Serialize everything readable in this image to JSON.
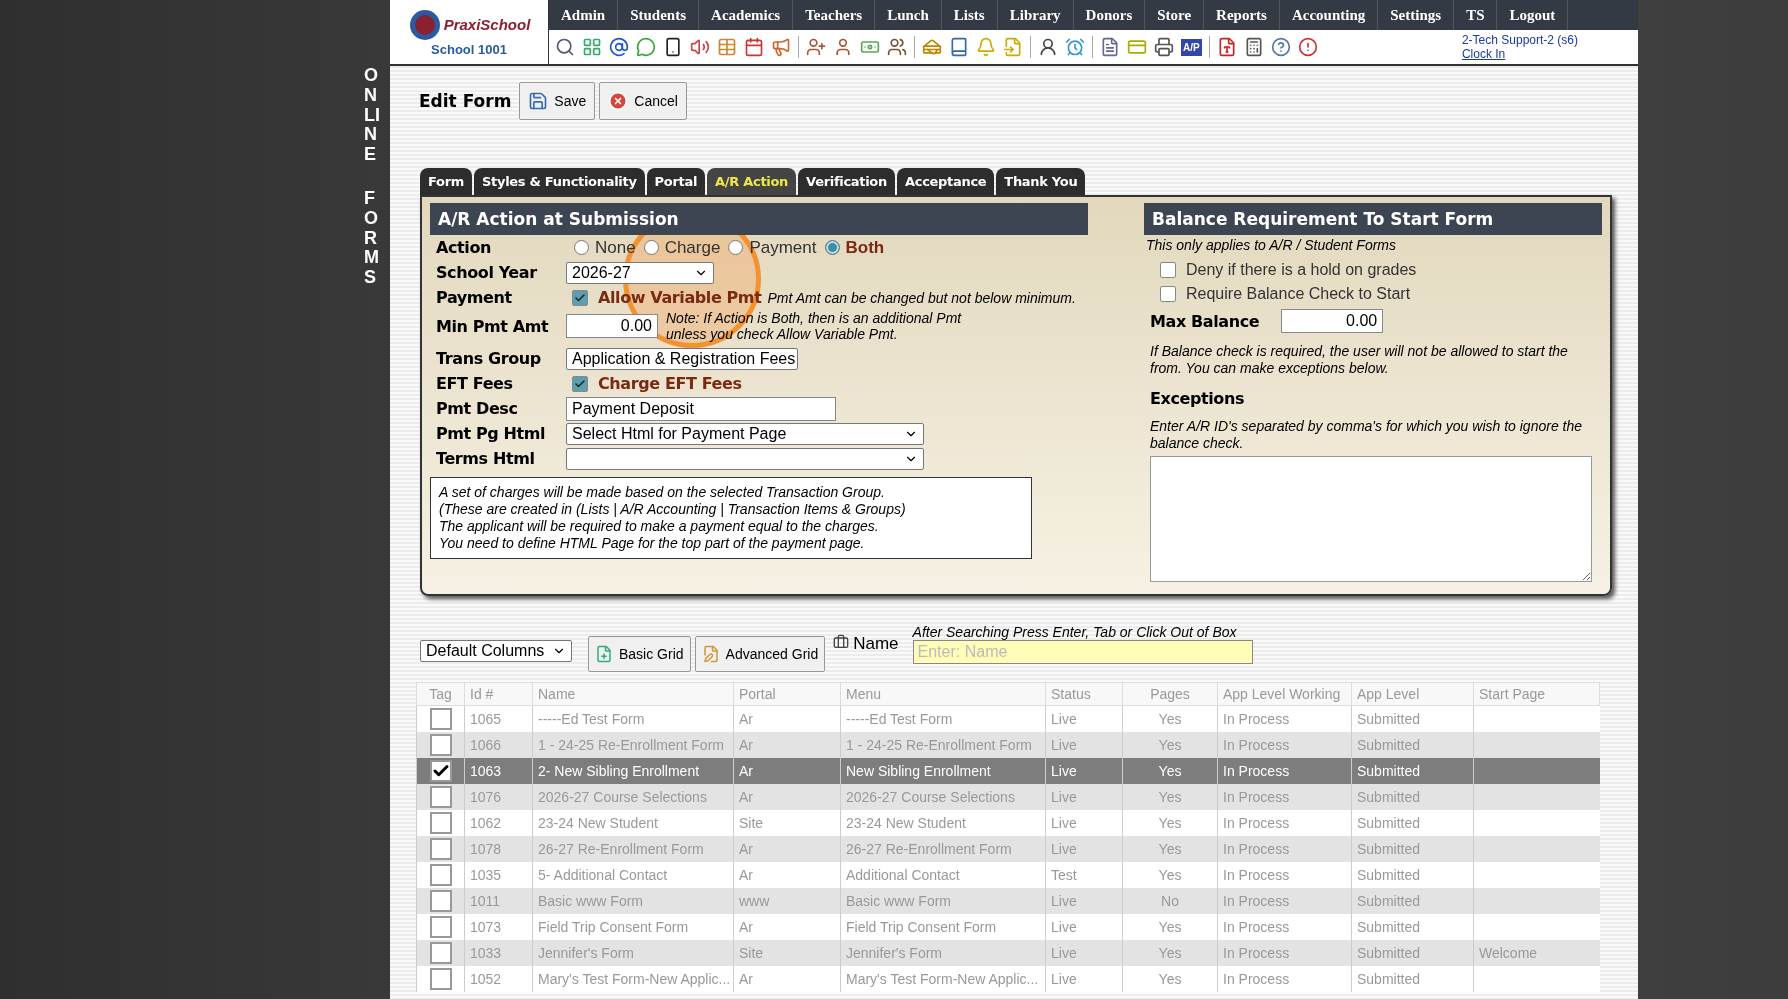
{
  "side_banner": [
    "ONLINE",
    "FORMS"
  ],
  "logo": {
    "brand": "PraxiSchool",
    "school": "School 1001"
  },
  "nav": [
    "Admin",
    "Students",
    "Academics",
    "Teachers",
    "Lunch",
    "Lists",
    "Library",
    "Donors",
    "Store",
    "Reports",
    "Accounting",
    "Settings",
    "TS",
    "Logout"
  ],
  "toolbar_badge": "A/P",
  "user": {
    "name": "2-Tech Support-2 (s6)",
    "link": "Clock In"
  },
  "header": {
    "title": "Edit Form",
    "buttons": [
      {
        "label": "Save",
        "kind": "save"
      },
      {
        "label": "Cancel",
        "kind": "cancel"
      }
    ]
  },
  "tabs": [
    {
      "label": "Form",
      "selected": false
    },
    {
      "label": "Styles & Functionality",
      "selected": false
    },
    {
      "label": "Portal",
      "selected": false
    },
    {
      "label": "A/R Action",
      "selected": true
    },
    {
      "label": "Verification",
      "selected": false
    },
    {
      "label": "Acceptance",
      "selected": false
    },
    {
      "label": "Thank You",
      "selected": false
    }
  ],
  "ar_panel": {
    "title": "A/R Action at Submission",
    "action": {
      "label": "Action",
      "options": [
        {
          "label": "None",
          "selected": false
        },
        {
          "label": "Charge",
          "selected": false
        },
        {
          "label": "Payment",
          "selected": false
        },
        {
          "label": "Both",
          "selected": true
        }
      ]
    },
    "school_year": {
      "label": "School Year",
      "value": "2026-27"
    },
    "payment": {
      "label": "Payment",
      "checkbox_label": "Allow Variable Pmt",
      "checked": true,
      "note": "Pmt Amt can be changed but not below minimum."
    },
    "min_pmt": {
      "label": "Min Pmt Amt",
      "value": "0.00",
      "note": "Note: If Action is Both, then is an additional Pmt unless you check Allow Variable Pmt."
    },
    "trans_group": {
      "label": "Trans Group",
      "value": "Application & Registration Fees"
    },
    "eft_fees": {
      "label": "EFT Fees",
      "checkbox_label": "Charge EFT Fees",
      "checked": true
    },
    "pmt_desc": {
      "label": "Pmt Desc",
      "value": "Payment Deposit"
    },
    "pmt_pg_html": {
      "label": "Pmt Pg Html",
      "value": "Select Html for Payment Page"
    },
    "terms_html": {
      "label": "Terms Html"
    },
    "info_lines": [
      "A set of charges will be made based on the selected Transaction Group.",
      "(These are created in (Lists | A/R Accounting | Transaction Items & Groups)",
      "The applicant will be required to make a payment equal to the charges.",
      "You need to define HTML Page for the top part of the payment page."
    ]
  },
  "balance_panel": {
    "title": "Balance Requirement To Start Form",
    "subtitle": "This only applies to A/R / Student Forms",
    "checkboxes": [
      {
        "label": "Deny if there is a hold on grades",
        "checked": false
      },
      {
        "label": "Require Balance Check to Start",
        "checked": false
      }
    ],
    "max_balance": {
      "label": "Max Balance",
      "value": "0.00"
    },
    "note": "If Balance check is required, the user will not be allowed to start the from. You can make exceptions below.",
    "exceptions": {
      "title": "Exceptions",
      "note": "Enter A/R ID's separated by comma's for which you wish to ignore the balance check."
    }
  },
  "grid_toolbar": {
    "columns_select": "Default Columns",
    "buttons": [
      {
        "label": "Basic Grid",
        "kind": "basic"
      },
      {
        "label": "Advanced Grid",
        "kind": "advanced"
      }
    ],
    "search_label": "Name",
    "hint": "After Searching Press Enter, Tab or Click Out of Box",
    "placeholder": "Enter: Name"
  },
  "table": {
    "columns": [
      "Tag",
      "Id #",
      "Name",
      "Portal",
      "Menu",
      "Status",
      "Pages",
      "App Level Working",
      "App Level",
      "Start Page"
    ],
    "rows": [
      {
        "checked": false,
        "selected": false,
        "cells": [
          "",
          "1065",
          "-----Ed Test Form",
          "Ar",
          "-----Ed Test Form",
          "Live",
          "Yes",
          "In Process",
          "Submitted"
        ]
      },
      {
        "checked": false,
        "selected": false,
        "cells": [
          "",
          "1066",
          "1 - 24-25 Re-Enrollment Form",
          "Ar",
          "1 - 24-25 Re-Enrollment Form",
          "Live",
          "Yes",
          "In Process",
          "Submitted"
        ]
      },
      {
        "checked": true,
        "selected": true,
        "cells": [
          "",
          "1063",
          "2- New Sibling Enrollment",
          "Ar",
          "New Sibling Enrollment",
          "Live",
          "Yes",
          "In Process",
          "Submitted"
        ]
      },
      {
        "checked": false,
        "selected": false,
        "cells": [
          "",
          "1076",
          "2026-27 Course Selections",
          "Ar",
          "2026-27 Course Selections",
          "Live",
          "Yes",
          "In Process",
          "Submitted"
        ]
      },
      {
        "checked": false,
        "selected": false,
        "cells": [
          "",
          "1062",
          "23-24 New Student",
          "Site",
          "23-24 New Student",
          "Live",
          "Yes",
          "In Process",
          "Submitted"
        ]
      },
      {
        "checked": false,
        "selected": false,
        "cells": [
          "",
          "1078",
          "26-27 Re-Enrollment Form",
          "Ar",
          "26-27 Re-Enrollment Form",
          "Live",
          "Yes",
          "In Process",
          "Submitted"
        ]
      },
      {
        "checked": false,
        "selected": false,
        "cells": [
          "",
          "1035",
          "5- Additional Contact",
          "Ar",
          "Additional Contact",
          "Test",
          "Yes",
          "In Process",
          "Submitted"
        ]
      },
      {
        "checked": false,
        "selected": false,
        "cells": [
          "",
          "1011",
          "Basic www Form",
          "www",
          "Basic www Form",
          "Live",
          "No",
          "In Process",
          "Submitted"
        ]
      },
      {
        "checked": false,
        "selected": false,
        "cells": [
          "",
          "1073",
          "Field Trip Consent Form",
          "Ar",
          "Field Trip Consent Form",
          "Live",
          "Yes",
          "In Process",
          "Submitted"
        ]
      },
      {
        "checked": false,
        "selected": false,
        "cells": [
          "",
          "1033",
          "Jennifer's Form",
          "Site",
          "Jennifer's Form",
          "Live",
          "Yes",
          "In Process",
          "Submitted",
          "Welcome"
        ]
      },
      {
        "checked": false,
        "selected": false,
        "cells": [
          "",
          "1052",
          "Mary's Test Form-New Applic...",
          "Ar",
          "Mary's Test Form-New Applic...",
          "Live",
          "Yes",
          "In Process",
          "Submitted"
        ]
      }
    ]
  }
}
